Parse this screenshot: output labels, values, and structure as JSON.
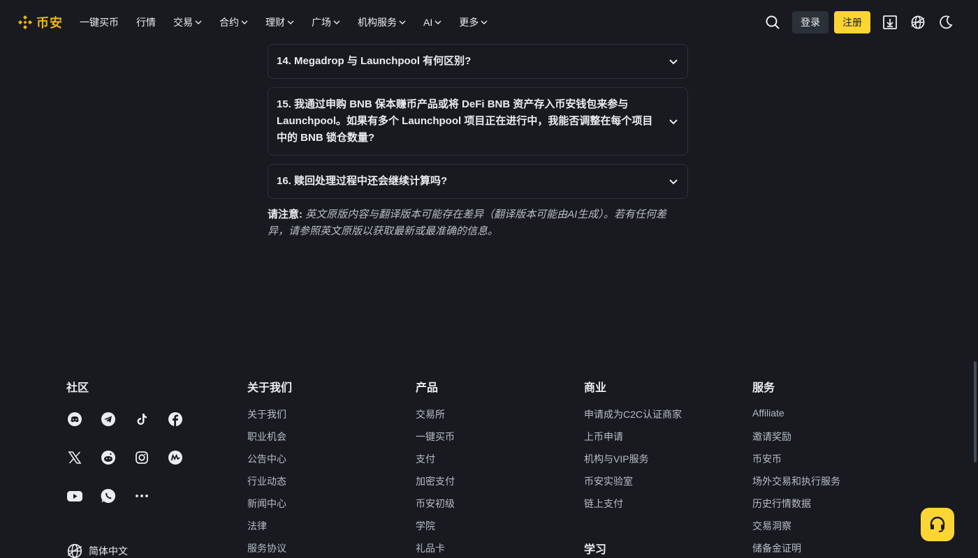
{
  "header": {
    "logo_text": "币安",
    "nav": [
      {
        "label": "一键买币",
        "dropdown": false
      },
      {
        "label": "行情",
        "dropdown": false
      },
      {
        "label": "交易",
        "dropdown": true
      },
      {
        "label": "合约",
        "dropdown": true
      },
      {
        "label": "理财",
        "dropdown": true
      },
      {
        "label": "广场",
        "dropdown": true
      },
      {
        "label": "机构服务",
        "dropdown": true
      },
      {
        "label": "AI",
        "dropdown": true
      },
      {
        "label": "更多",
        "dropdown": true
      }
    ],
    "login_label": "登录",
    "register_label": "注册"
  },
  "faq": {
    "items": [
      {
        "question": "14. Megadrop 与 Launchpool 有何区别?"
      },
      {
        "question": "15. 我通过申购 BNB 保本赚币产品或将 DeFi BNB 资产存入币安钱包来参与 Launchpool。如果有多个 Launchpool 项目正在进行中，我能否调整在每个项目中的 BNB 锁仓数量?"
      },
      {
        "question": "16. 赎回处理过程中还会继续计算吗?"
      }
    ],
    "notice_label": "请注意:",
    "notice_text": " 英文原版内容与翻译版本可能存在差异（翻译版本可能由AI生成）。若有任何差异，请参照英文原版以获取最新或最准确的信息。"
  },
  "footer": {
    "community": {
      "title": "社区",
      "icons": [
        "discord-icon",
        "telegram-icon",
        "tiktok-icon",
        "facebook-icon",
        "x-icon",
        "reddit-icon",
        "instagram-icon",
        "coinmarketcap-icon",
        "youtube-icon",
        "whatsapp-icon",
        "more-icon"
      ]
    },
    "about": {
      "title": "关于我们",
      "links": [
        "关于我们",
        "职业机会",
        "公告中心",
        "行业动态",
        "新闻中心",
        "法律",
        "服务协议"
      ]
    },
    "products": {
      "title": "产品",
      "links": [
        "交易所",
        "一键买币",
        "支付",
        "加密支付",
        "币安初级",
        "学院",
        "礼品卡"
      ]
    },
    "business": {
      "title": "商业",
      "links": [
        "申请成为C2C认证商家",
        "上币申请",
        "机构与VIP服务",
        "币安实验室",
        "链上支付"
      ]
    },
    "learn": {
      "title": "学习"
    },
    "services": {
      "title": "服务",
      "links": [
        "Affiliate",
        "邀请奖励",
        "币安币",
        "场外交易和执行服务",
        "历史行情数据",
        "交易洞察",
        "储备金证明"
      ]
    },
    "language": "简体中文"
  },
  "colors": {
    "background": "#181a20",
    "brand": "#f0b90b",
    "accent": "#fcd535"
  }
}
